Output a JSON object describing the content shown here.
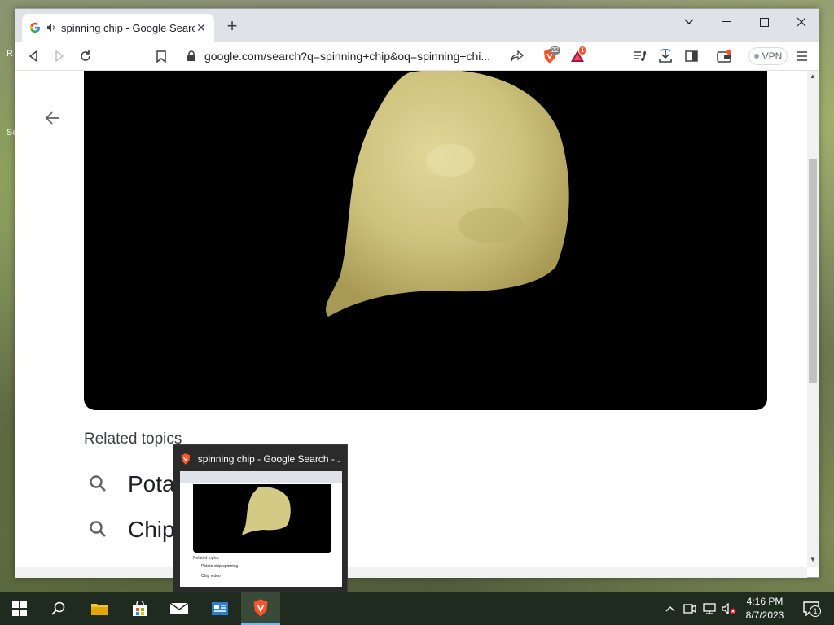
{
  "browser": {
    "tab_title": "spinning chip - Google Search",
    "url": "google.com/search?q=spinning+chip&oq=spinning+chi...",
    "shields_count": "22",
    "rewards_count": "1",
    "vpn_label": "VPN"
  },
  "page": {
    "related_heading": "Related topics",
    "related_items": [
      "Potat",
      "Chip"
    ]
  },
  "preview": {
    "title": "spinning chip - Google Search -...",
    "mini_related_heading": "Related topics",
    "mini_items": [
      "Potato chip spinning",
      "Chip video"
    ]
  },
  "taskbar": {
    "time": "4:16 PM",
    "date": "8/7/2023",
    "notification_count": "1"
  },
  "desktop": {
    "partial_labels": [
      "R",
      "Se"
    ]
  },
  "colors": {
    "taskbar_bg": "#1f2b1e",
    "brave_orange": "#fb542b",
    "video_bg": "#000000",
    "chip_color": "#d7cf8a"
  }
}
